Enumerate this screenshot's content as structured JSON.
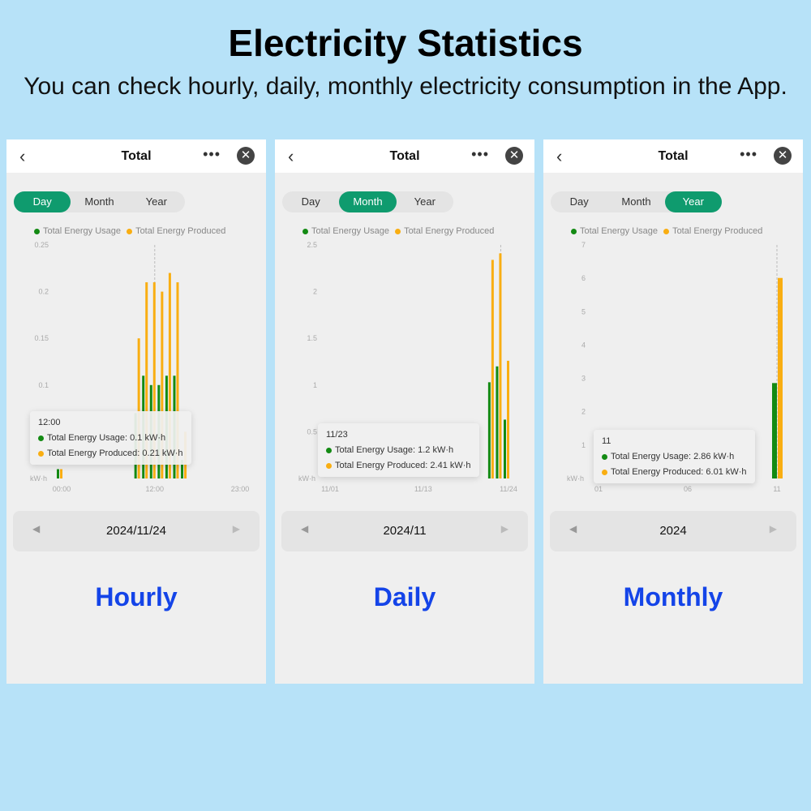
{
  "title": "Electricity Statistics",
  "subtitle": "You can check hourly, daily, monthly electricity consumption in the App.",
  "colors": {
    "usage": "#138a13",
    "produced": "#f9ae12",
    "accent": "#0f9b6e",
    "caption": "#1444e8"
  },
  "panels": [
    {
      "header": "Total",
      "tabs": [
        "Day",
        "Month",
        "Year"
      ],
      "active_tab": 0,
      "legend": [
        "Total Energy Usage",
        "Total Energy Produced"
      ],
      "date": "2024/11/24",
      "caption": "Hourly",
      "tooltip": {
        "label": "12:00",
        "usage": "Total Energy Usage: 0.1 kW·h",
        "produced": "Total Energy Produced: 0.21 kW·h"
      }
    },
    {
      "header": "Total",
      "tabs": [
        "Day",
        "Month",
        "Year"
      ],
      "active_tab": 1,
      "legend": [
        "Total Energy Usage",
        "Total Energy Produced"
      ],
      "date": "2024/11",
      "caption": "Daily",
      "tooltip": {
        "label": "11/23",
        "usage": "Total Energy Usage: 1.2 kW·h",
        "produced": "Total Energy Produced: 2.41 kW·h"
      }
    },
    {
      "header": "Total",
      "tabs": [
        "Day",
        "Month",
        "Year"
      ],
      "active_tab": 2,
      "legend": [
        "Total Energy Usage",
        "Total Energy Produced"
      ],
      "date": "2024",
      "caption": "Monthly",
      "tooltip": {
        "label": "11",
        "usage": "Total Energy Usage: 2.86 kW·h",
        "produced": "Total Energy Produced: 6.01 kW·h"
      }
    }
  ],
  "chart_data": [
    {
      "type": "bar",
      "ylabel": "kW·h",
      "ylim": [
        0,
        0.25
      ],
      "yticks": [
        "0.25",
        "0.2",
        "0.15",
        "0.1",
        "0.05"
      ],
      "xticks": [
        "00:00",
        "12:00",
        "23:00"
      ],
      "n": 24,
      "xtick_index": [
        0,
        12,
        23
      ],
      "highlight": 12,
      "series": [
        {
          "name": "Total Energy Usage",
          "points": [
            [
              0,
              0.01
            ],
            [
              10,
              0.07
            ],
            [
              11,
              0.11
            ],
            [
              12,
              0.1
            ],
            [
              13,
              0.1
            ],
            [
              14,
              0.11
            ],
            [
              15,
              0.11
            ],
            [
              16,
              0.02
            ]
          ]
        },
        {
          "name": "Total Energy Produced",
          "points": [
            [
              0,
              0.01
            ],
            [
              10,
              0.15
            ],
            [
              11,
              0.21
            ],
            [
              12,
              0.21
            ],
            [
              13,
              0.2
            ],
            [
              14,
              0.22
            ],
            [
              15,
              0.21
            ],
            [
              16,
              0.05
            ]
          ]
        }
      ]
    },
    {
      "type": "bar",
      "ylabel": "kW·h",
      "ylim": [
        0,
        2.5
      ],
      "yticks": [
        "2.5",
        "2",
        "1.5",
        "1",
        "0.5"
      ],
      "xticks": [
        "11/01",
        "11/13",
        "11/24"
      ],
      "n": 24,
      "xtick_index": [
        0,
        12,
        23
      ],
      "highlight": 22,
      "series": [
        {
          "name": "Total Energy Usage",
          "points": [
            [
              21,
              1.03
            ],
            [
              22,
              1.2
            ],
            [
              23,
              0.63
            ]
          ]
        },
        {
          "name": "Total Energy Produced",
          "points": [
            [
              21,
              2.34
            ],
            [
              22,
              2.41
            ],
            [
              23,
              1.26
            ]
          ]
        }
      ]
    },
    {
      "type": "bar",
      "ylabel": "kW·h",
      "ylim": [
        0,
        7
      ],
      "yticks": [
        "7",
        "6",
        "5",
        "4",
        "3",
        "2",
        "1"
      ],
      "xticks": [
        "01",
        "06",
        "11"
      ],
      "n": 11,
      "xtick_index": [
        0,
        5,
        10
      ],
      "highlight": 10,
      "series": [
        {
          "name": "Total Energy Usage",
          "points": [
            [
              10,
              2.86
            ]
          ]
        },
        {
          "name": "Total Energy Produced",
          "points": [
            [
              10,
              6.01
            ]
          ]
        }
      ]
    }
  ]
}
